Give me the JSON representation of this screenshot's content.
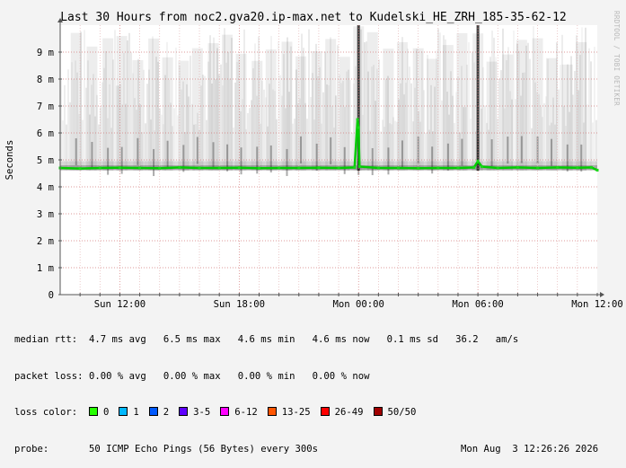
{
  "chart_data": {
    "type": "area",
    "title": "Last 30 Hours from noc2.gva20.ip-max.net to Kudelski_HE_ZRH_185-35-62-12",
    "ylabel": "Seconds",
    "xlabel": "",
    "yticks": [
      {
        "value": 0,
        "label": "0"
      },
      {
        "value": 1,
        "label": "1 m"
      },
      {
        "value": 2,
        "label": "2 m"
      },
      {
        "value": 3,
        "label": "3 m"
      },
      {
        "value": 4,
        "label": "4 m"
      },
      {
        "value": 5,
        "label": "5 m"
      },
      {
        "value": 6,
        "label": "6 m"
      },
      {
        "value": 7,
        "label": "7 m"
      },
      {
        "value": 8,
        "label": "8 m"
      },
      {
        "value": 9,
        "label": "9 m"
      }
    ],
    "ylim": [
      0,
      10
    ],
    "xlim_hours": [
      -27.0,
      0.0
    ],
    "xticks": [
      {
        "hours": -24,
        "label": "Sun 12:00"
      },
      {
        "hours": -18,
        "label": "Sun 18:00"
      },
      {
        "hours": -12,
        "label": "Mon 00:00"
      },
      {
        "hours": -6,
        "label": "Mon 06:00"
      },
      {
        "hours": 0,
        "label": "Mon 12:00"
      }
    ],
    "grid": true,
    "median_rtt": {
      "x": [
        -27.0,
        -26.0,
        -25.0,
        -24.0,
        -23.0,
        -22.0,
        -21.0,
        -20.0,
        -19.0,
        -18.0,
        -17.0,
        -16.0,
        -15.0,
        -14.0,
        -13.0,
        -12.2,
        -12.05,
        -12.0,
        -11.95,
        -11.0,
        -10.0,
        -9.0,
        -8.0,
        -7.0,
        -6.2,
        -6.0,
        -5.8,
        -5.0,
        -4.0,
        -3.0,
        -2.0,
        -1.0,
        -0.3,
        0.0
      ],
      "y": [
        4.7,
        4.68,
        4.7,
        4.71,
        4.7,
        4.69,
        4.72,
        4.7,
        4.7,
        4.71,
        4.69,
        4.7,
        4.7,
        4.71,
        4.7,
        4.72,
        6.5,
        6.2,
        4.75,
        4.7,
        4.7,
        4.69,
        4.7,
        4.7,
        4.72,
        4.95,
        4.75,
        4.7,
        4.72,
        4.7,
        4.72,
        4.71,
        4.72,
        4.62
      ]
    },
    "spikes_hours": [
      -26.2,
      -25.4,
      -24.6,
      -23.9,
      -23.1,
      -22.3,
      -21.6,
      -20.8,
      -20.1,
      -19.3,
      -18.6,
      -17.9,
      -17.1,
      -16.4,
      -15.6,
      -14.9,
      -14.1,
      -13.4,
      -12.7,
      -12.0,
      -11.3,
      -10.5,
      -9.8,
      -9.0,
      -8.3,
      -7.5,
      -6.8,
      -6.0,
      -5.3,
      -4.5,
      -3.8,
      -3.0,
      -2.3,
      -1.5,
      -0.8
    ],
    "series": [
      {
        "name": "median rtt",
        "color": "#00cc00"
      }
    ]
  },
  "stats": {
    "median_rtt_label": "median rtt:",
    "median_rtt_values": "4.7 ms avg   6.5 ms max   4.6 ms min   4.6 ms now   0.1 ms sd   36.2   am/s",
    "packet_loss_label": "packet loss:",
    "packet_loss_values": "0.00 % avg   0.00 % max   0.00 % min   0.00 % now",
    "loss_color_label": "loss color:",
    "loss_colors": [
      {
        "label": "0",
        "color": "#26ff00"
      },
      {
        "label": "1",
        "color": "#00b8ff"
      },
      {
        "label": "2",
        "color": "#0059ff"
      },
      {
        "label": "3-5",
        "color": "#5e00ff"
      },
      {
        "label": "6-12",
        "color": "#ff00ff"
      },
      {
        "label": "13-25",
        "color": "#ff5500"
      },
      {
        "label": "26-49",
        "color": "#ff0000"
      },
      {
        "label": "50/50",
        "color": "#a10000"
      }
    ],
    "probe_label": "probe:",
    "probe_value": "50 ICMP Echo Pings (56 Bytes) every 300s",
    "timestamp": "Mon Aug  3 12:26:26 2026"
  },
  "watermark": "RRDTOOL / TOBI OETIKER"
}
